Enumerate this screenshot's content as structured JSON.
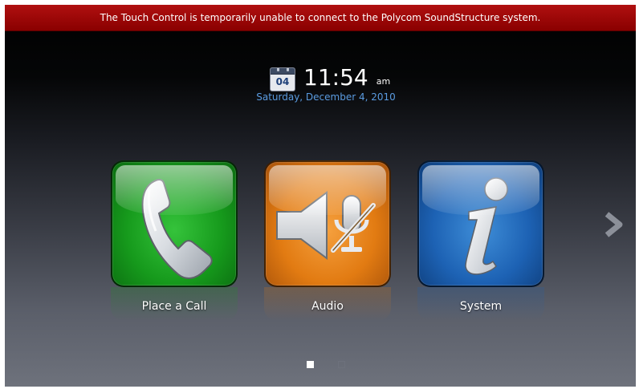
{
  "banner": {
    "message": "The Touch Control is temporarily unable to connect to the Polycom SoundStructure system."
  },
  "clock": {
    "calendar_icon": "calendar-icon",
    "calendar_day": "04",
    "time": "11:54",
    "ampm": "am",
    "date": "Saturday, December 4, 2010"
  },
  "tiles": [
    {
      "label": "Place a Call",
      "icon": "phone-icon",
      "color": "#169a1c"
    },
    {
      "label": "Audio",
      "icon": "speaker-mute-icon",
      "color": "#e27b12"
    },
    {
      "label": "System",
      "icon": "info-icon",
      "color": "#1d62b4"
    }
  ],
  "navigation": {
    "next_icon": "chevron-right-icon",
    "pages": 2,
    "current_page": 1
  },
  "colors": {
    "banner": "#8a0000",
    "date_text": "#5a9be0"
  }
}
